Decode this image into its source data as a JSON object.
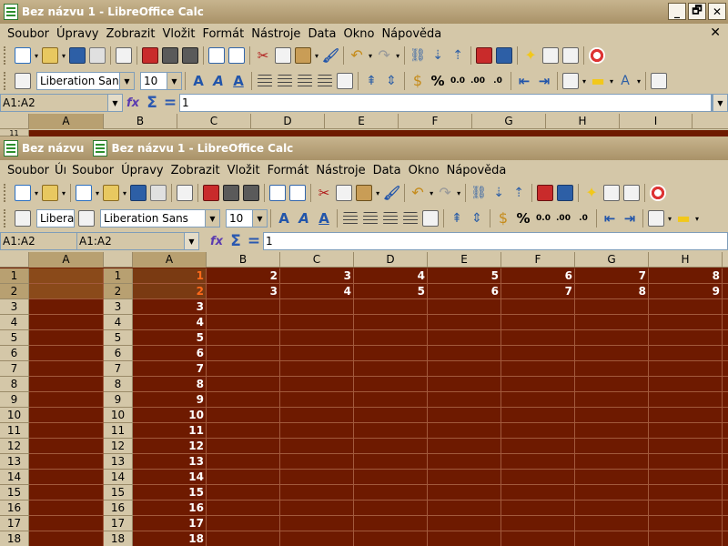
{
  "back_window": {
    "title": "Bez názvu 1 - LibreOffice Calc",
    "controls": [
      "_",
      "🗗",
      "✕"
    ],
    "menus": [
      "Soubor",
      "Úpravy",
      "Zobrazit",
      "Vložit",
      "Formát",
      "Nástroje",
      "Data",
      "Okno",
      "Nápověda"
    ],
    "menu_close": "✕",
    "font_name": "Liberation Sans",
    "font_size": "10",
    "name_box": "A1:A2",
    "formula_value": "1",
    "columns": [
      "A",
      "B",
      "C",
      "D",
      "E",
      "F",
      "G",
      "H",
      "I"
    ],
    "row_visible": "11"
  },
  "front_window": {
    "title": "Bez názvu 1 - LibreOffice Calc",
    "tab_title": "Bez názvu",
    "menus": [
      "Soubor",
      "Úpravy",
      "Zobrazit",
      "Vložit",
      "Formát",
      "Nástroje",
      "Data",
      "Okno",
      "Nápověda"
    ],
    "menu_fragment": "Úı",
    "font_fragment": "Libera",
    "font_name": "Liberation Sans",
    "font_size": "10",
    "name_box_left": "A1:A2",
    "name_box": "A1:A2",
    "formula_value": "1",
    "left_pane_column": "A",
    "columns": [
      "A",
      "B",
      "C",
      "D",
      "E",
      "F",
      "G",
      "H"
    ],
    "row_numbers": [
      "1",
      "2",
      "3",
      "4",
      "5",
      "6",
      "7",
      "8",
      "9",
      "10",
      "11",
      "12",
      "13",
      "14",
      "15",
      "16",
      "17",
      "18"
    ],
    "rows": [
      [
        "1",
        "2",
        "3",
        "4",
        "5",
        "6",
        "7",
        "8"
      ],
      [
        "2",
        "3",
        "4",
        "5",
        "6",
        "7",
        "8",
        "9"
      ],
      [
        "3",
        "",
        "",
        "",
        "",
        "",
        "",
        ""
      ],
      [
        "4",
        "",
        "",
        "",
        "",
        "",
        "",
        ""
      ],
      [
        "5",
        "",
        "",
        "",
        "",
        "",
        "",
        ""
      ],
      [
        "6",
        "",
        "",
        "",
        "",
        "",
        "",
        ""
      ],
      [
        "7",
        "",
        "",
        "",
        "",
        "",
        "",
        ""
      ],
      [
        "8",
        "",
        "",
        "",
        "",
        "",
        "",
        ""
      ],
      [
        "9",
        "",
        "",
        "",
        "",
        "",
        "",
        ""
      ],
      [
        "10",
        "",
        "",
        "",
        "",
        "",
        "",
        ""
      ],
      [
        "11",
        "",
        "",
        "",
        "",
        "",
        "",
        ""
      ],
      [
        "12",
        "",
        "",
        "",
        "",
        "",
        "",
        ""
      ],
      [
        "13",
        "",
        "",
        "",
        "",
        "",
        "",
        ""
      ],
      [
        "14",
        "",
        "",
        "",
        "",
        "",
        "",
        ""
      ],
      [
        "15",
        "",
        "",
        "",
        "",
        "",
        "",
        ""
      ],
      [
        "16",
        "",
        "",
        "",
        "",
        "",
        "",
        ""
      ],
      [
        "17",
        "",
        "",
        "",
        "",
        "",
        "",
        ""
      ],
      [
        "18",
        "",
        "",
        "",
        "",
        "",
        "",
        ""
      ]
    ]
  },
  "colors": {
    "sheet_bg": "#6e1a00",
    "chrome_bg": "#d4c7a8",
    "active_cell_text": "#ff6a1a"
  }
}
